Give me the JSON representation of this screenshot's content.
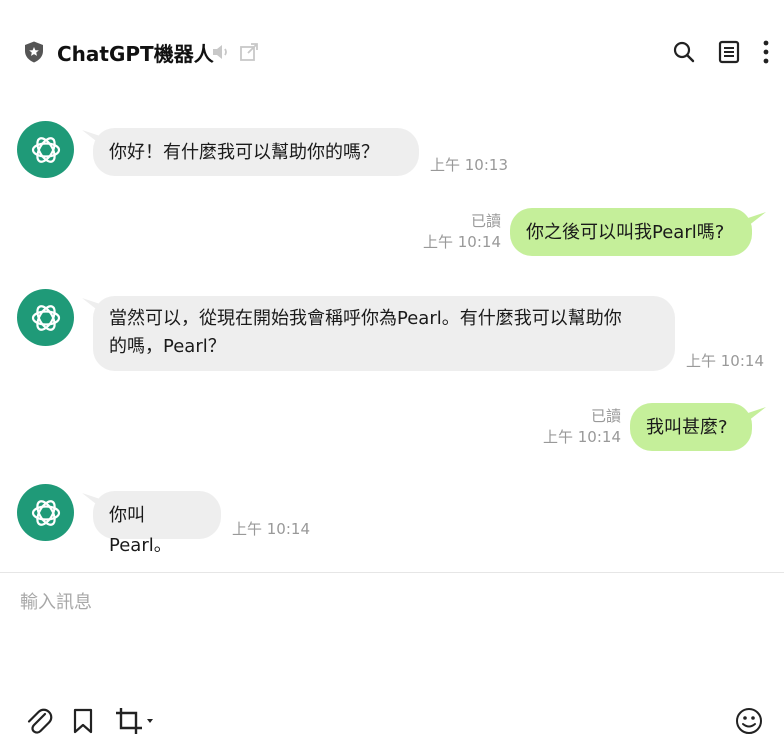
{
  "header": {
    "title": "ChatGPT機器人",
    "icons": [
      "shield-star-icon",
      "speaker-muted-icon",
      "external-open-icon",
      "search-icon",
      "notes-icon",
      "more-icon"
    ]
  },
  "messages": [
    {
      "from": "bot",
      "text": "你好！有什麼我可以幫助你的嗎？",
      "time": "上午 10:13"
    },
    {
      "from": "user",
      "text": "你之後可以叫我Pearl嗎?",
      "read": "已讀",
      "time": "上午 10:14"
    },
    {
      "from": "bot",
      "text_line1": "當然可以，從現在開始我會稱呼你為Pearl。有什麼我可以幫助你",
      "text_line2": "的嗎，Pearl？",
      "time": "上午 10:14"
    },
    {
      "from": "user",
      "text": "我叫甚麼?",
      "read": "已讀",
      "time": "上午 10:14"
    },
    {
      "from": "bot",
      "text": "你叫Pearl。",
      "time": "上午 10:14"
    }
  ],
  "composer": {
    "placeholder": "輸入訊息",
    "value": ""
  },
  "toolbar": {
    "icons": [
      "paperclip-icon",
      "bookmark-icon",
      "crop-icon",
      "emoji-icon"
    ]
  },
  "colors": {
    "avatar": "#1f9a78",
    "incoming_bubble": "#eeeeee",
    "outgoing_bubble": "#c5ef9a",
    "meta_text": "#999999"
  }
}
